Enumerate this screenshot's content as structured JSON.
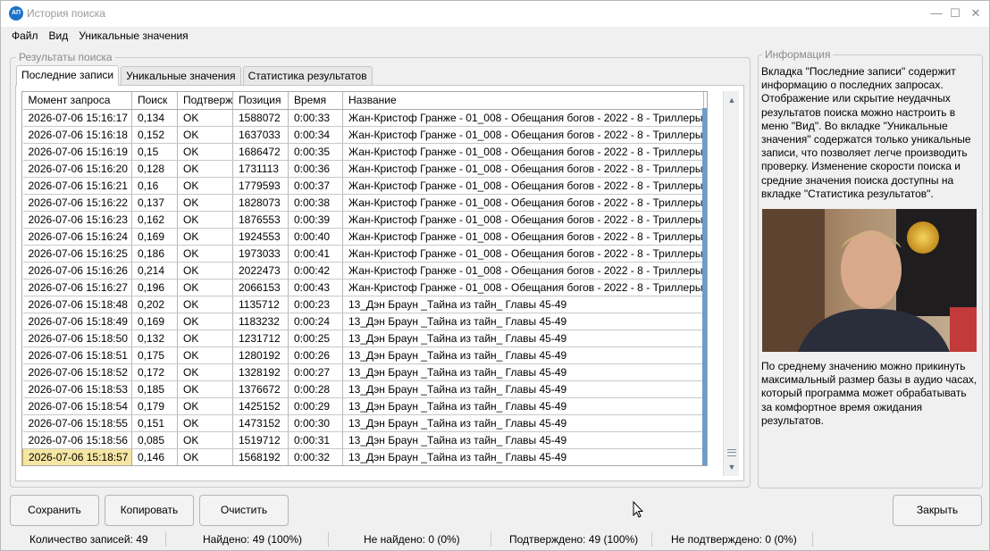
{
  "window": {
    "title": "История поиска",
    "app_icon_text": "АП",
    "controls": {
      "minimize": "—",
      "maximize": "☐",
      "close": "✕"
    }
  },
  "menu": [
    "Файл",
    "Вид",
    "Уникальные значения"
  ],
  "results_group": {
    "title": "Результаты поиска",
    "tabs": [
      "Последние записи",
      "Уникальные значения",
      "Статистика результатов"
    ],
    "active_tab": 0
  },
  "table": {
    "columns": [
      "Момент запроса",
      "Поиск",
      "Подтверж",
      "Позиция",
      "Время",
      "Название"
    ],
    "rows": [
      [
        "2026-07-06 15:16:17",
        "0,134",
        "OK",
        "1588072",
        "0:00:33",
        "Жан-Кристоф Гранже - 01_008 - Обещания богов - 2022 - 8 - Триллеры"
      ],
      [
        "2026-07-06 15:16:18",
        "0,152",
        "OK",
        "1637033",
        "0:00:34",
        "Жан-Кристоф Гранже - 01_008 - Обещания богов - 2022 - 8 - Триллеры"
      ],
      [
        "2026-07-06 15:16:19",
        "0,15",
        "OK",
        "1686472",
        "0:00:35",
        "Жан-Кристоф Гранже - 01_008 - Обещания богов - 2022 - 8 - Триллеры"
      ],
      [
        "2026-07-06 15:16:20",
        "0,128",
        "OK",
        "1731113",
        "0:00:36",
        "Жан-Кристоф Гранже - 01_008 - Обещания богов - 2022 - 8 - Триллеры"
      ],
      [
        "2026-07-06 15:16:21",
        "0,16",
        "OK",
        "1779593",
        "0:00:37",
        "Жан-Кристоф Гранже - 01_008 - Обещания богов - 2022 - 8 - Триллеры"
      ],
      [
        "2026-07-06 15:16:22",
        "0,137",
        "OK",
        "1828073",
        "0:00:38",
        "Жан-Кристоф Гранже - 01_008 - Обещания богов - 2022 - 8 - Триллеры"
      ],
      [
        "2026-07-06 15:16:23",
        "0,162",
        "OK",
        "1876553",
        "0:00:39",
        "Жан-Кристоф Гранже - 01_008 - Обещания богов - 2022 - 8 - Триллеры"
      ],
      [
        "2026-07-06 15:16:24",
        "0,169",
        "OK",
        "1924553",
        "0:00:40",
        "Жан-Кристоф Гранже - 01_008 - Обещания богов - 2022 - 8 - Триллеры"
      ],
      [
        "2026-07-06 15:16:25",
        "0,186",
        "OK",
        "1973033",
        "0:00:41",
        "Жан-Кристоф Гранже - 01_008 - Обещания богов - 2022 - 8 - Триллеры"
      ],
      [
        "2026-07-06 15:16:26",
        "0,214",
        "OK",
        "2022473",
        "0:00:42",
        "Жан-Кристоф Гранже - 01_008 - Обещания богов - 2022 - 8 - Триллеры"
      ],
      [
        "2026-07-06 15:16:27",
        "0,196",
        "OK",
        "2066153",
        "0:00:43",
        "Жан-Кристоф Гранже - 01_008 - Обещания богов - 2022 - 8 - Триллеры"
      ],
      [
        "2026-07-06 15:18:48",
        "0,202",
        "OK",
        "1135712",
        "0:00:23",
        "13_Дэн Браун _Тайна из тайн_ Главы 45-49"
      ],
      [
        "2026-07-06 15:18:49",
        "0,169",
        "OK",
        "1183232",
        "0:00:24",
        "13_Дэн Браун _Тайна из тайн_ Главы 45-49"
      ],
      [
        "2026-07-06 15:18:50",
        "0,132",
        "OK",
        "1231712",
        "0:00:25",
        "13_Дэн Браун _Тайна из тайн_ Главы 45-49"
      ],
      [
        "2026-07-06 15:18:51",
        "0,175",
        "OK",
        "1280192",
        "0:00:26",
        "13_Дэн Браун _Тайна из тайн_ Главы 45-49"
      ],
      [
        "2026-07-06 15:18:52",
        "0,172",
        "OK",
        "1328192",
        "0:00:27",
        "13_Дэн Браун _Тайна из тайн_ Главы 45-49"
      ],
      [
        "2026-07-06 15:18:53",
        "0,185",
        "OK",
        "1376672",
        "0:00:28",
        "13_Дэн Браун _Тайна из тайн_ Главы 45-49"
      ],
      [
        "2026-07-06 15:18:54",
        "0,179",
        "OK",
        "1425152",
        "0:00:29",
        "13_Дэн Браун _Тайна из тайн_ Главы 45-49"
      ],
      [
        "2026-07-06 15:18:55",
        "0,151",
        "OK",
        "1473152",
        "0:00:30",
        "13_Дэн Браун _Тайна из тайн_ Главы 45-49"
      ],
      [
        "2026-07-06 15:18:56",
        "0,085",
        "OK",
        "1519712",
        "0:00:31",
        "13_Дэн Браун _Тайна из тайн_ Главы 45-49"
      ],
      [
        "2026-07-06 15:18:57",
        "0,146",
        "OK",
        "1568192",
        "0:00:32",
        "13_Дэн Браун _Тайна из тайн_ Главы 45-49"
      ]
    ],
    "selected_row": 20
  },
  "info_group": {
    "title": "Информация",
    "text1": "Вкладка \"Последние записи\" содержит информацию о последних запросах. Отображение или скрытие неудачных результатов поиска можно настроить в меню \"Вид\". Во вкладке \"Уникальные значения\" содержатся только уникальные записи, что позволяет легче производить проверку. Изменение скорости поиска и средние значения поиска доступны на вкладке \"Статистика результатов\".",
    "text2": "По среднему значению можно прикинуть максимальный размер базы в аудио часах, который программа может обрабатывать за комфортное время ожидания результатов."
  },
  "buttons": {
    "save": "Сохранить",
    "copy": "Копировать",
    "clear": "Очистить",
    "close": "Закрыть"
  },
  "status": {
    "count": "Количество записей: 49",
    "found": "Найдено: 49 (100%)",
    "not_found": "Не найдено: 0 (0%)",
    "confirmed": "Подтверждено: 49 (100%)",
    "not_confirmed": "Не подтверждено: 0 (0%)"
  },
  "colors": {
    "selected_row_bg": "#f5e6a4",
    "scroll_accent": "#6e9ccc"
  }
}
